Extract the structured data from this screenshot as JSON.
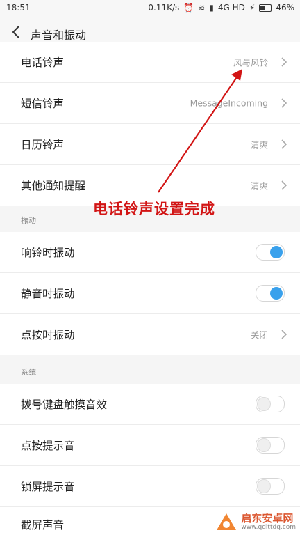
{
  "statusbar": {
    "time": "18:51",
    "speed": "0.11K/s",
    "network": "4G HD",
    "battery": "46%"
  },
  "header": {
    "title": "声音和振动"
  },
  "ringtones": [
    {
      "label": "电话铃声",
      "value": "风与风铃"
    },
    {
      "label": "短信铃声",
      "value": "MessageIncoming"
    },
    {
      "label": "日历铃声",
      "value": "清爽"
    },
    {
      "label": "其他通知提醒",
      "value": "清爽"
    }
  ],
  "vibration": {
    "title": "振动",
    "items": [
      {
        "label": "响铃时振动",
        "state": "on"
      },
      {
        "label": "静音时振动",
        "state": "on"
      },
      {
        "label": "点按时振动",
        "value": "关闭"
      }
    ]
  },
  "system": {
    "title": "系统",
    "items": [
      {
        "label": "拨号键盘触摸音效",
        "state": "off"
      },
      {
        "label": "点按提示音",
        "state": "off"
      },
      {
        "label": "锁屏提示音",
        "state": "off"
      },
      {
        "label": "截屏声音"
      }
    ]
  },
  "annotation": {
    "text": "电话铃声设置完成",
    "color": "#d21515"
  },
  "watermark": {
    "name": "启东安卓网",
    "url": "www.qdlttdq.com"
  },
  "colors": {
    "accent": "#3aa1ec"
  }
}
